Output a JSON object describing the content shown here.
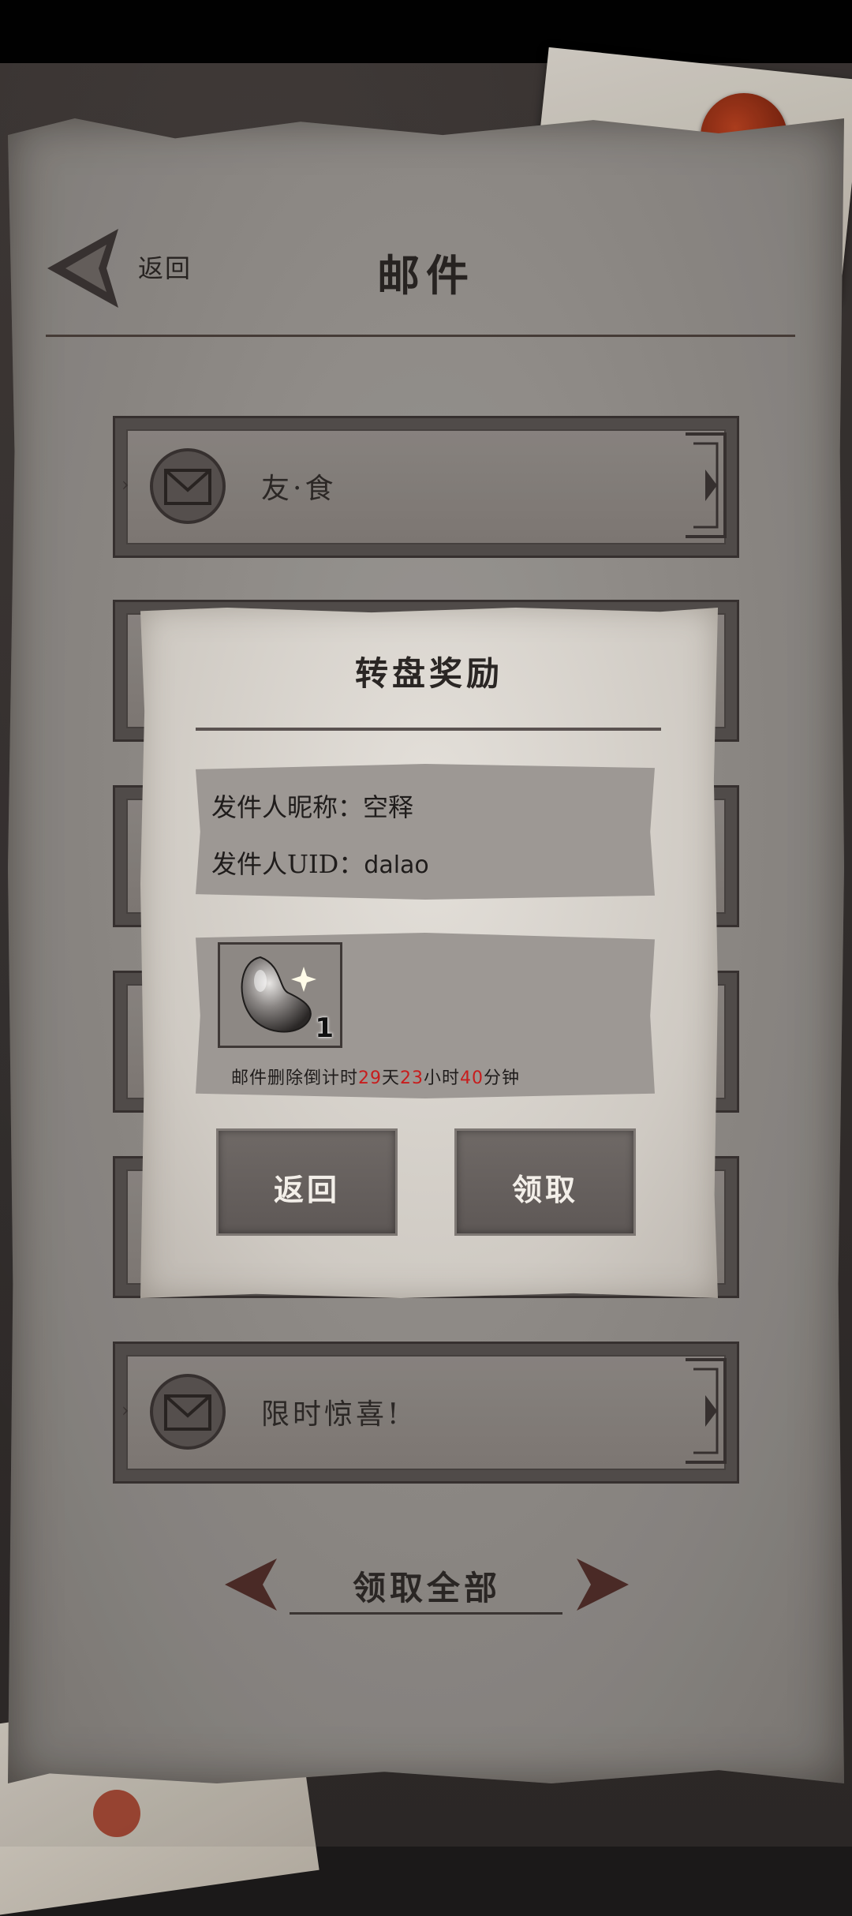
{
  "header": {
    "back_label": "返回",
    "title": "邮件"
  },
  "mail_list": [
    {
      "label": "友·食"
    },
    {
      "label": ""
    },
    {
      "label": ""
    },
    {
      "label": ""
    },
    {
      "label": ""
    },
    {
      "label": "限时惊喜!"
    }
  ],
  "dialog": {
    "title": "转盘奖励",
    "sender_name_label": "发件人昵称：",
    "sender_name_value": "空释",
    "sender_uid_label": "发件人UID：",
    "sender_uid_value": "dalao",
    "attachment": {
      "item_icon": "bean-icon",
      "count": "1"
    },
    "countdown": {
      "prefix": "邮件删除倒计时",
      "days": "29",
      "days_unit": "天",
      "hours": "23",
      "hours_unit": "小时",
      "minutes": "40",
      "minutes_unit": "分钟"
    },
    "back_button": "返回",
    "claim_button": "领取"
  },
  "footer": {
    "claim_all": "领取全部"
  },
  "colors": {
    "countdown_number": "#c81c1c",
    "wax_seal": "#9b3018",
    "button_bg": "#655f5c"
  }
}
